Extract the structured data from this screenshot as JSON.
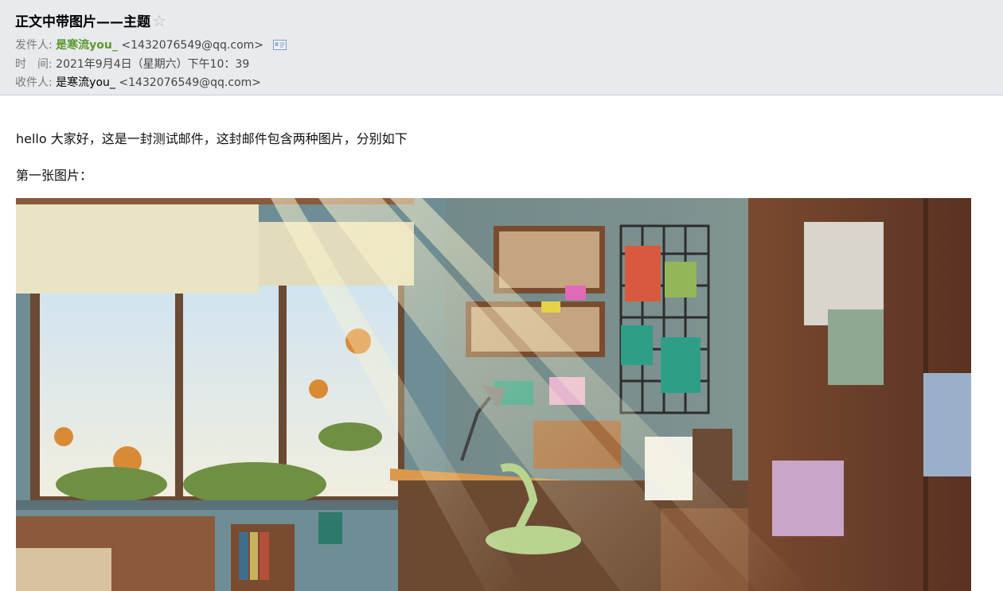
{
  "email": {
    "subject": "正文中带图片——主题",
    "star_icon": "star-outline-icon",
    "from_label": "发件人:",
    "from_name": "是寒流you_",
    "from_address": "<1432076549@qq.com>",
    "contact_card_icon": "contact-card-icon",
    "time_label": "时　间:",
    "time_value": "2021年9月4日（星期六）下午10：39",
    "to_label": "收件人:",
    "to_name": "是寒流you_",
    "to_address": "<1432076549@qq.com>"
  },
  "body": {
    "line1": "hello 大家好，这是一封测试邮件，这封邮件包含两种图片，分别如下",
    "line2": "第一张图片：",
    "image_alt": "anime-style bedroom with sunlit window, desk and wardrobe"
  },
  "colors": {
    "header_bg": "#e9eaee",
    "sender_name": "#5b9a2e"
  }
}
